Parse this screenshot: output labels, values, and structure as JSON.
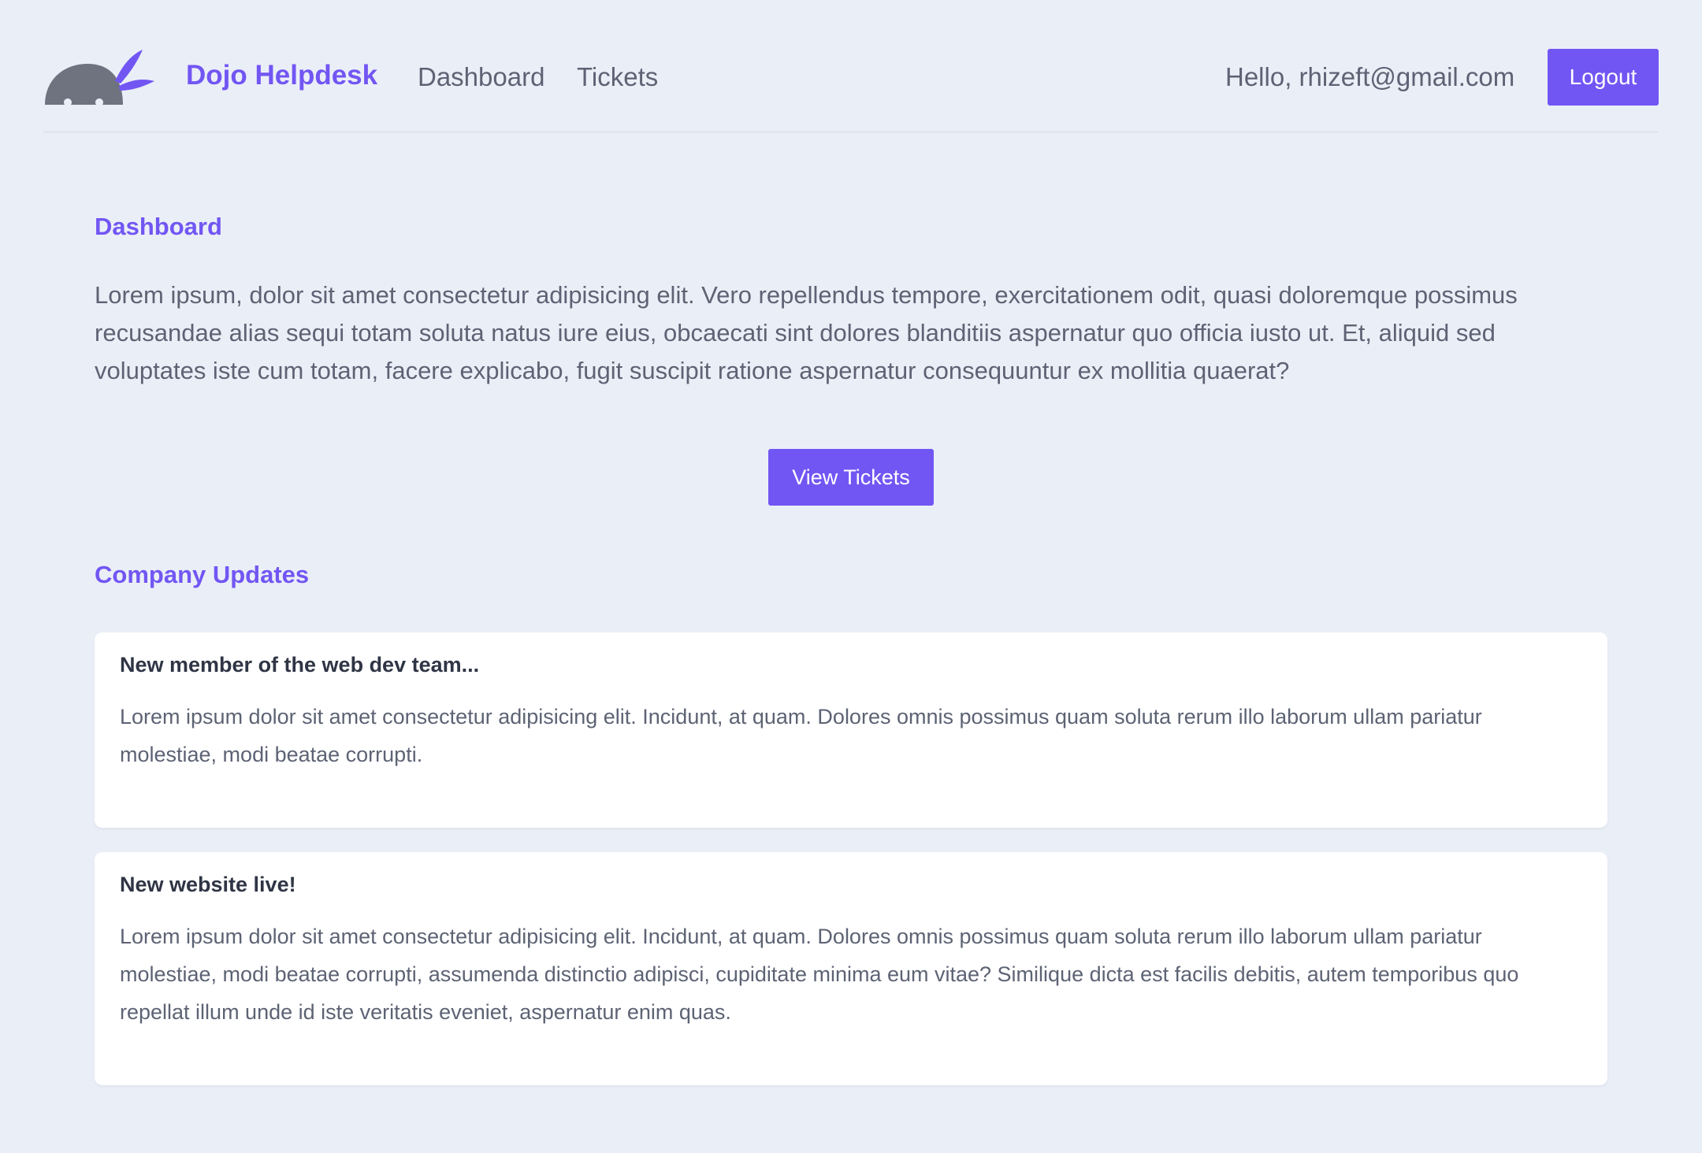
{
  "nav": {
    "brand": "Dojo Helpdesk",
    "links": [
      "Dashboard",
      "Tickets"
    ],
    "greeting": "Hello, rhizeft@gmail.com",
    "logout_label": "Logout"
  },
  "main": {
    "title": "Dashboard",
    "intro": "Lorem ipsum, dolor sit amet consectetur adipisicing elit. Vero repellendus tempore, exercitationem odit, quasi doloremque possimus recusandae alias sequi totam soluta natus iure eius, obcaecati sint dolores blanditiis aspernatur quo officia iusto ut. Et, aliquid sed voluptates iste cum totam, facere explicabo, fugit suscipit ratione aspernatur consequuntur ex mollitia quaerat?",
    "cta_label": "View Tickets",
    "updates_title": "Company Updates",
    "updates": [
      {
        "title": "New member of the web dev team...",
        "body": "Lorem ipsum dolor sit amet consectetur adipisicing elit. Incidunt, at quam. Dolores omnis possimus quam soluta rerum illo laborum ullam pariatur molestiae, modi beatae corrupti."
      },
      {
        "title": "New website live!",
        "body": "Lorem ipsum dolor sit amet consectetur adipisicing elit. Incidunt, at quam. Dolores omnis possimus quam soluta rerum illo laborum ullam pariatur molestiae, modi beatae corrupti, assumenda distinctio adipisci, cupiditate minima eum vitae? Similique dicta est facilis debitis, autem temporibus quo repellat illum unde id iste veritatis eveniet, aspernatur enim quas."
      }
    ]
  },
  "colors": {
    "accent": "#7256f3",
    "background": "#eaeff7",
    "card": "#ffffff",
    "text": "#5d6374",
    "heading_dark": "#2f3545"
  },
  "icons": {
    "logo": "ninja-logo-icon"
  }
}
